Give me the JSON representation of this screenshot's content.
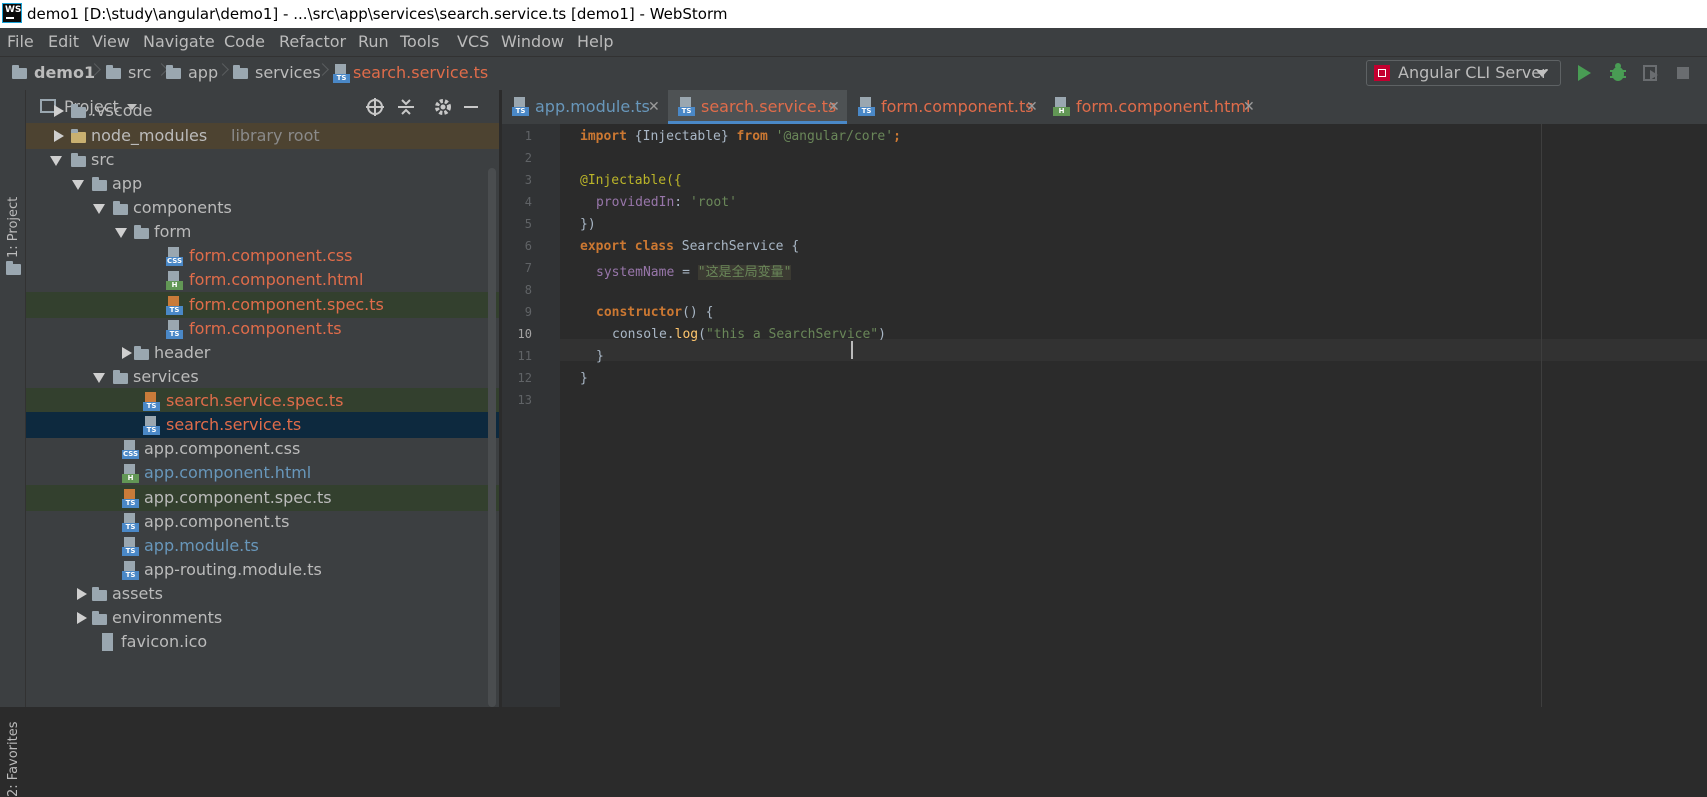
{
  "window": {
    "title": "demo1 [D:\\study\\angular\\demo1] - ...\\src\\app\\services\\search.service.ts [demo1] - WebStorm",
    "logo_text": "WS"
  },
  "menu": [
    "File",
    "Edit",
    "View",
    "Navigate",
    "Code",
    "Refactor",
    "Run",
    "Tools",
    "VCS",
    "Window",
    "Help"
  ],
  "breadcrumb": [
    "demo1",
    "src",
    "app",
    "services",
    "search.service.ts"
  ],
  "run_config": {
    "label": "Angular CLI Server"
  },
  "left_strip": {
    "project_label": "1: Project",
    "favorites_label": "2: Favorites"
  },
  "project_panel": {
    "title": "Project",
    "tree": [
      {
        "label": ".vscode",
        "suffix": "",
        "color": "#bbbbbb"
      },
      {
        "label": "node_modules",
        "suffix": "library root",
        "color": "#bbbbbb"
      },
      {
        "label": "src",
        "suffix": "",
        "color": "#bbbbbb"
      },
      {
        "label": "app",
        "suffix": "",
        "color": "#bbbbbb"
      },
      {
        "label": "components",
        "suffix": "",
        "color": "#bbbbbb"
      },
      {
        "label": "form",
        "suffix": "",
        "color": "#bbbbbb"
      },
      {
        "label": "form.component.css",
        "suffix": "",
        "color": "#e06c4a"
      },
      {
        "label": "form.component.html",
        "suffix": "",
        "color": "#e06c4a"
      },
      {
        "label": "form.component.spec.ts",
        "suffix": "",
        "color": "#e06c4a"
      },
      {
        "label": "form.component.ts",
        "suffix": "",
        "color": "#e06c4a"
      },
      {
        "label": "header",
        "suffix": "",
        "color": "#bbbbbb"
      },
      {
        "label": "services",
        "suffix": "",
        "color": "#bbbbbb"
      },
      {
        "label": "search.service.spec.ts",
        "suffix": "",
        "color": "#e06c4a"
      },
      {
        "label": "search.service.ts",
        "suffix": "",
        "color": "#e06c4a"
      },
      {
        "label": "app.component.css",
        "suffix": "",
        "color": "#bbbbbb"
      },
      {
        "label": "app.component.html",
        "suffix": "",
        "color": "#6897bb"
      },
      {
        "label": "app.component.spec.ts",
        "suffix": "",
        "color": "#bbbbbb"
      },
      {
        "label": "app.component.ts",
        "suffix": "",
        "color": "#bbbbbb"
      },
      {
        "label": "app.module.ts",
        "suffix": "",
        "color": "#6897bb"
      },
      {
        "label": "app-routing.module.ts",
        "suffix": "",
        "color": "#bbbbbb"
      },
      {
        "label": "assets",
        "suffix": "",
        "color": "#bbbbbb"
      },
      {
        "label": "environments",
        "suffix": "",
        "color": "#bbbbbb"
      },
      {
        "label": "favicon.ico",
        "suffix": "",
        "color": "#bbbbbb"
      }
    ]
  },
  "tabs": [
    {
      "label": "app.module.ts",
      "color": "#6897bb",
      "icon": "TS"
    },
    {
      "label": "search.service.ts",
      "color": "#e06c4a",
      "icon": "TS"
    },
    {
      "label": "form.component.ts",
      "color": "#e06c4a",
      "icon": "TS"
    },
    {
      "label": "form.component.html",
      "color": "#e06c4a",
      "icon": "H"
    }
  ],
  "editor": {
    "line_numbers": [
      "1",
      "2",
      "3",
      "4",
      "5",
      "6",
      "7",
      "8",
      "9",
      "10",
      "11",
      "12",
      "13"
    ],
    "code": {
      "l1_import": "import",
      "l1_mid": " {Injectable} ",
      "l1_from": "from",
      "l1_str": " '@angular/core'",
      "l1_end": ";",
      "l3": "@Injectable({",
      "l4_key": "providedIn",
      "l4_colon": ": ",
      "l4_val": "'root'",
      "l5": "})",
      "l6_export": "export",
      "l6_class": " class",
      "l6_rest": " SearchService {",
      "l7_key": "systemName",
      "l7_eq": " = ",
      "l7_val": "\"这是全局变量\"",
      "l9_kw": "constructor",
      "l9_rest": "() {",
      "l10_obj": "console.",
      "l10_fn": "log",
      "l10_open": "(",
      "l10_str": "\"this a SearchService\"",
      "l10_close": ")",
      "l11": "}",
      "l12": "}"
    }
  },
  "colors": {
    "accent": "#4a88c7",
    "error_file": "#e06c4a",
    "modified_file": "#6897bb"
  }
}
